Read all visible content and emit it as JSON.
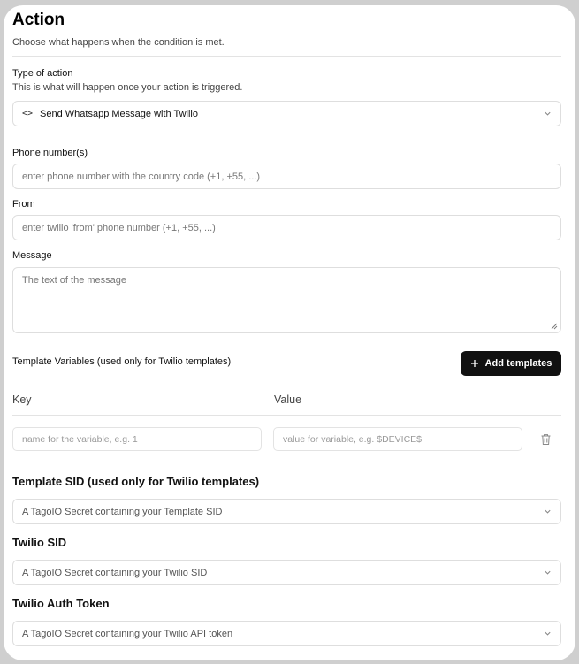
{
  "header": {
    "title": "Action",
    "subtitle": "Choose what happens when the condition is met."
  },
  "action_type": {
    "label": "Type of action",
    "help": "This is what will happen once your action is triggered.",
    "selected": "Send Whatsapp Message with Twilio",
    "icon": "code-icon"
  },
  "phone": {
    "label": "Phone number(s)",
    "placeholder": "enter phone number with the country code (+1, +55, ...)"
  },
  "from": {
    "label": "From",
    "placeholder": "enter twilio 'from' phone number (+1, +55, ...)"
  },
  "message": {
    "label": "Message",
    "placeholder": "The text of the message"
  },
  "template_vars": {
    "label": "Template Variables (used only for Twilio templates)",
    "add_button": "Add templates",
    "key_header": "Key",
    "value_header": "Value",
    "key_placeholder": "name for the variable, e.g. 1",
    "value_placeholder": "value for variable, e.g. $DEVICE$"
  },
  "template_sid": {
    "label": "Template SID (used only for Twilio templates)",
    "placeholder": "A TagoIO Secret containing your Template SID"
  },
  "twilio_sid": {
    "label": "Twilio SID",
    "placeholder": "A TagoIO Secret containing your Twilio SID"
  },
  "twilio_token": {
    "label": "Twilio Auth Token",
    "placeholder": "A TagoIO Secret containing your Twilio API token"
  }
}
